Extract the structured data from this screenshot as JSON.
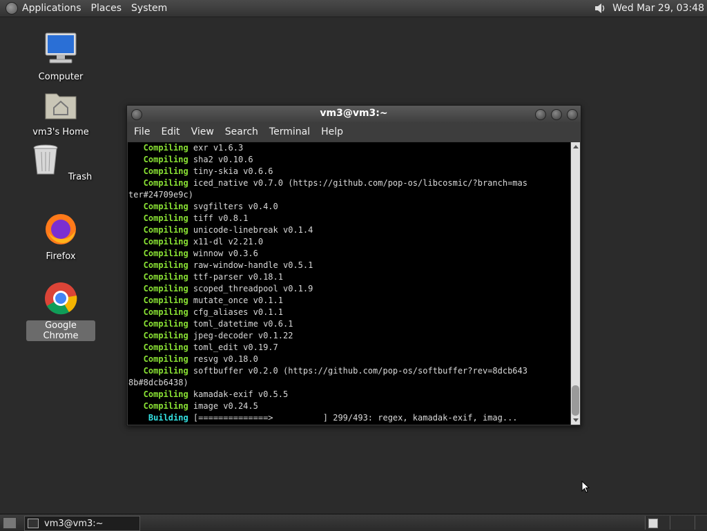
{
  "top_panel": {
    "menus": [
      "Applications",
      "Places",
      "System"
    ],
    "clock": "Wed Mar 29, 03:48"
  },
  "desktop": {
    "icons": [
      {
        "label": "Computer",
        "icon": "computer-icon"
      },
      {
        "label": "vm3's Home",
        "icon": "home-folder-icon"
      },
      {
        "label": "Trash",
        "icon": "trash-icon"
      },
      {
        "label": "Firefox",
        "icon": "firefox-icon"
      },
      {
        "label": "Google Chrome",
        "icon": "chrome-icon"
      }
    ]
  },
  "terminal": {
    "title": "vm3@vm3:~",
    "menus": [
      "File",
      "Edit",
      "View",
      "Search",
      "Terminal",
      "Help"
    ],
    "lines": [
      {
        "kw": "Compiling",
        "text": " exr v1.6.3"
      },
      {
        "kw": "Compiling",
        "text": " sha2 v0.10.6"
      },
      {
        "kw": "Compiling",
        "text": " tiny-skia v0.6.6"
      },
      {
        "kw": "Compiling",
        "text": " iced_native v0.7.0 (https://github.com/pop-os/libcosmic/?branch=mas"
      },
      {
        "kw": "",
        "text": "ter#24709e9c)"
      },
      {
        "kw": "Compiling",
        "text": " svgfilters v0.4.0"
      },
      {
        "kw": "Compiling",
        "text": " tiff v0.8.1"
      },
      {
        "kw": "Compiling",
        "text": " unicode-linebreak v0.1.4"
      },
      {
        "kw": "Compiling",
        "text": " x11-dl v2.21.0"
      },
      {
        "kw": "Compiling",
        "text": " winnow v0.3.6"
      },
      {
        "kw": "Compiling",
        "text": " raw-window-handle v0.5.1"
      },
      {
        "kw": "Compiling",
        "text": " ttf-parser v0.18.1"
      },
      {
        "kw": "Compiling",
        "text": " scoped_threadpool v0.1.9"
      },
      {
        "kw": "Compiling",
        "text": " mutate_once v0.1.1"
      },
      {
        "kw": "Compiling",
        "text": " cfg_aliases v0.1.1"
      },
      {
        "kw": "Compiling",
        "text": " toml_datetime v0.6.1"
      },
      {
        "kw": "Compiling",
        "text": " jpeg-decoder v0.1.22"
      },
      {
        "kw": "Compiling",
        "text": " toml_edit v0.19.7"
      },
      {
        "kw": "Compiling",
        "text": " resvg v0.18.0"
      },
      {
        "kw": "Compiling",
        "text": " softbuffer v0.2.0 (https://github.com/pop-os/softbuffer?rev=8dcb643"
      },
      {
        "kw": "",
        "text": "8b#8dcb6438)"
      },
      {
        "kw": "Compiling",
        "text": " kamadak-exif v0.5.5"
      },
      {
        "kw": "Compiling",
        "text": " image v0.24.5"
      }
    ],
    "building": {
      "kw": "Building",
      "text": " [==============>          ] 299/493: regex, kamadak-exif, imag..."
    }
  },
  "taskbar": {
    "task_label": "vm3@vm3:~"
  }
}
